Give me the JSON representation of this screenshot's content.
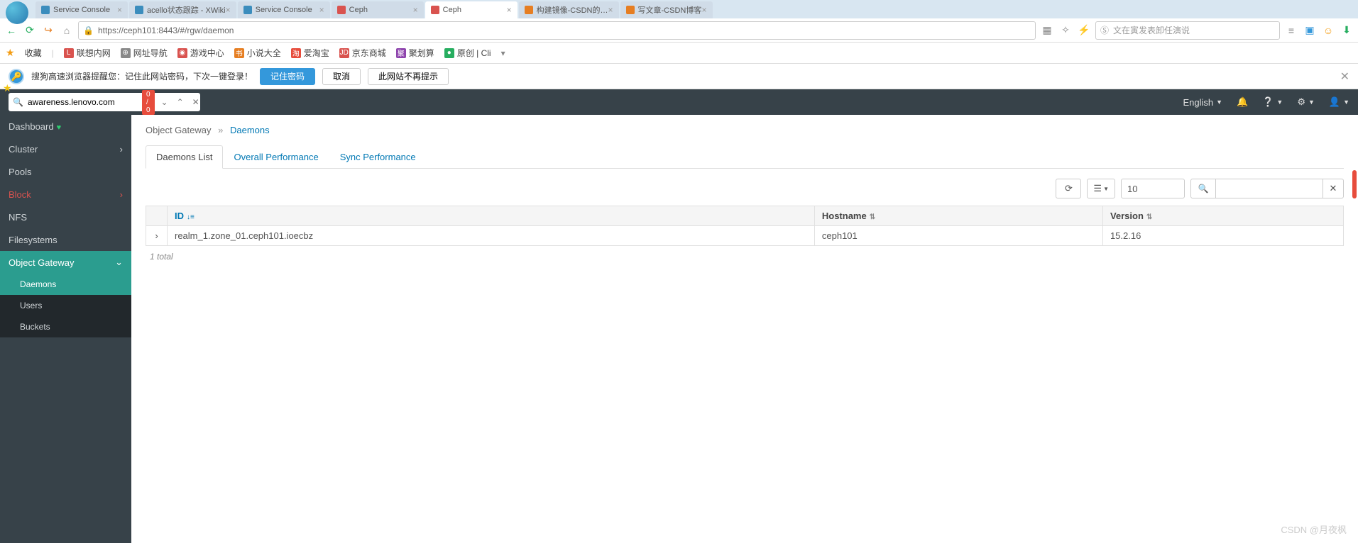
{
  "browser": {
    "tabs": [
      {
        "label": "Service Console",
        "iconColor": "blue"
      },
      {
        "label": "acello状态跟踪 - XWiki",
        "iconColor": "blue"
      },
      {
        "label": "Service Console",
        "iconColor": "blue"
      },
      {
        "label": "Ceph",
        "iconColor": "red"
      },
      {
        "label": "Ceph",
        "iconColor": "red",
        "active": true
      },
      {
        "label": "构建镜像-CSDN的…",
        "iconColor": "orange"
      },
      {
        "label": "写文章-CSDN博客",
        "iconColor": "orange"
      }
    ],
    "url": "https://ceph101:8443/#/rgw/daemon",
    "searchPlaceholder": "文在寅发表卸任演说"
  },
  "bookmarks": {
    "favLabel": "收藏",
    "items": [
      {
        "label": "联想内网",
        "icon": "L",
        "bg": "#d9534f"
      },
      {
        "label": "网址导航",
        "icon": "⊕",
        "bg": "#888"
      },
      {
        "label": "游戏中心",
        "icon": "◉",
        "bg": "#d9534f"
      },
      {
        "label": "小说大全",
        "icon": "书",
        "bg": "#e67e22"
      },
      {
        "label": "爱淘宝",
        "icon": "淘",
        "bg": "#e74c3c"
      },
      {
        "label": "京东商城",
        "icon": "JD",
        "bg": "#d9534f"
      },
      {
        "label": "聚划算",
        "icon": "聚",
        "bg": "#8e44ad"
      },
      {
        "label": "原创 | Cli",
        "icon": "●",
        "bg": "#27ae60"
      }
    ]
  },
  "passwordBar": {
    "text": "搜狗高速浏览器提醒您：记住此网站密码，下次一键登录！",
    "save": "记住密码",
    "cancel": "取消",
    "never": "此网站不再提示"
  },
  "pageSearch": {
    "value": "awareness.lenovo.com",
    "count": "0 / 0"
  },
  "header": {
    "language": "English"
  },
  "sidebar": {
    "dashboard": "Dashboard",
    "cluster": "Cluster",
    "pools": "Pools",
    "block": "Block",
    "nfs": "NFS",
    "filesystems": "Filesystems",
    "objectGateway": "Object Gateway",
    "sub": {
      "daemons": "Daemons",
      "users": "Users",
      "buckets": "Buckets"
    }
  },
  "breadcrumb": {
    "parent": "Object Gateway",
    "current": "Daemons"
  },
  "tabs": {
    "list": "Daemons List",
    "overall": "Overall Performance",
    "sync": "Sync Performance"
  },
  "table": {
    "pageSize": "10",
    "cols": {
      "id": "ID",
      "hostname": "Hostname",
      "version": "Version"
    },
    "rows": [
      {
        "id": "realm_1.zone_01.ceph101.ioecbz",
        "hostname": "ceph101",
        "version": "15.2.16"
      }
    ],
    "total": "1 total"
  },
  "watermark": "CSDN @月夜枫"
}
